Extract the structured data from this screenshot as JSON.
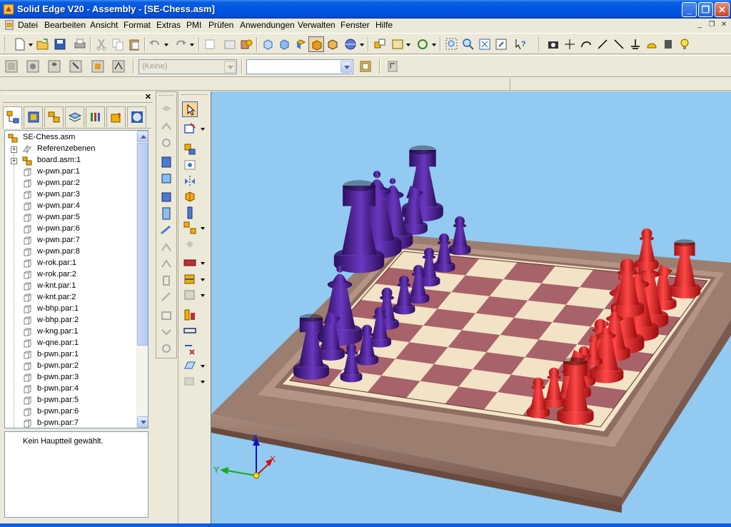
{
  "window": {
    "title": "Solid Edge V20 - Assembly - [SE-Chess.asm]"
  },
  "window_controls": {
    "minimize": "_",
    "restore": "❐",
    "close": "✕"
  },
  "menu": [
    {
      "label": "Datei"
    },
    {
      "label": "Bearbeiten"
    },
    {
      "label": "Ansicht"
    },
    {
      "label": "Format"
    },
    {
      "label": "Extras"
    },
    {
      "label": "PMI"
    },
    {
      "label": "Prüfen"
    },
    {
      "label": "Anwendungen"
    },
    {
      "label": "Verwalten"
    },
    {
      "label": "Fenster"
    },
    {
      "label": "Hilfe"
    }
  ],
  "toolbar2": {
    "style_combo_value": "(Keine)",
    "second_combo_value": ""
  },
  "tree": {
    "root": "SE-Chess.asm",
    "items": [
      {
        "label": "Referenzebenen",
        "icon": "reference-planes-icon",
        "expandable": true
      },
      {
        "label": "board.asm:1",
        "icon": "subassembly-icon",
        "expandable": true
      },
      {
        "label": "w-pwn.par:1",
        "icon": "part-icon"
      },
      {
        "label": "w-pwn.par:2",
        "icon": "part-icon"
      },
      {
        "label": "w-pwn.par:3",
        "icon": "part-icon"
      },
      {
        "label": "w-pwn.par:4",
        "icon": "part-icon"
      },
      {
        "label": "w-pwn.par:5",
        "icon": "part-icon"
      },
      {
        "label": "w-pwn.par:6",
        "icon": "part-icon"
      },
      {
        "label": "w-pwn.par:7",
        "icon": "part-icon"
      },
      {
        "label": "w-pwn.par:8",
        "icon": "part-icon"
      },
      {
        "label": "w-rok.par:1",
        "icon": "part-icon"
      },
      {
        "label": "w-rok.par:2",
        "icon": "part-icon"
      },
      {
        "label": "w-knt.par:1",
        "icon": "part-icon"
      },
      {
        "label": "w-knt.par:2",
        "icon": "part-icon"
      },
      {
        "label": "w-bhp.par:1",
        "icon": "part-icon"
      },
      {
        "label": "w-bhp.par:2",
        "icon": "part-icon"
      },
      {
        "label": "w-kng.par:1",
        "icon": "part-icon"
      },
      {
        "label": "w-qne.par:1",
        "icon": "part-icon"
      },
      {
        "label": "b-pwn.par:1",
        "icon": "part-icon"
      },
      {
        "label": "b-pwn.par:2",
        "icon": "part-icon"
      },
      {
        "label": "b-pwn.par:3",
        "icon": "part-icon"
      },
      {
        "label": "b-pwn.par:4",
        "icon": "part-icon"
      },
      {
        "label": "b-pwn.par:5",
        "icon": "part-icon"
      },
      {
        "label": "b-pwn.par:6",
        "icon": "part-icon"
      },
      {
        "label": "b-pwn.par:7",
        "icon": "part-icon"
      }
    ]
  },
  "properties": {
    "status": "Kein Hauptteil gewählt."
  },
  "triad": {
    "x": "X",
    "y": "Y",
    "z": "Z"
  },
  "colors": {
    "viewport_bg": "#92caf2",
    "purple_pieces": "#4a1f8c",
    "red_pieces": "#d21c1c",
    "board_frame": "#8c6a5c"
  }
}
